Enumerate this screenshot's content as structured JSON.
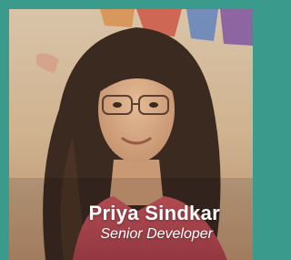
{
  "profile": {
    "name": "Priya Sindkar",
    "title": "Senior Developer"
  },
  "colors": {
    "frame": "#3a9b8c",
    "caption_text": "#ffffff"
  }
}
